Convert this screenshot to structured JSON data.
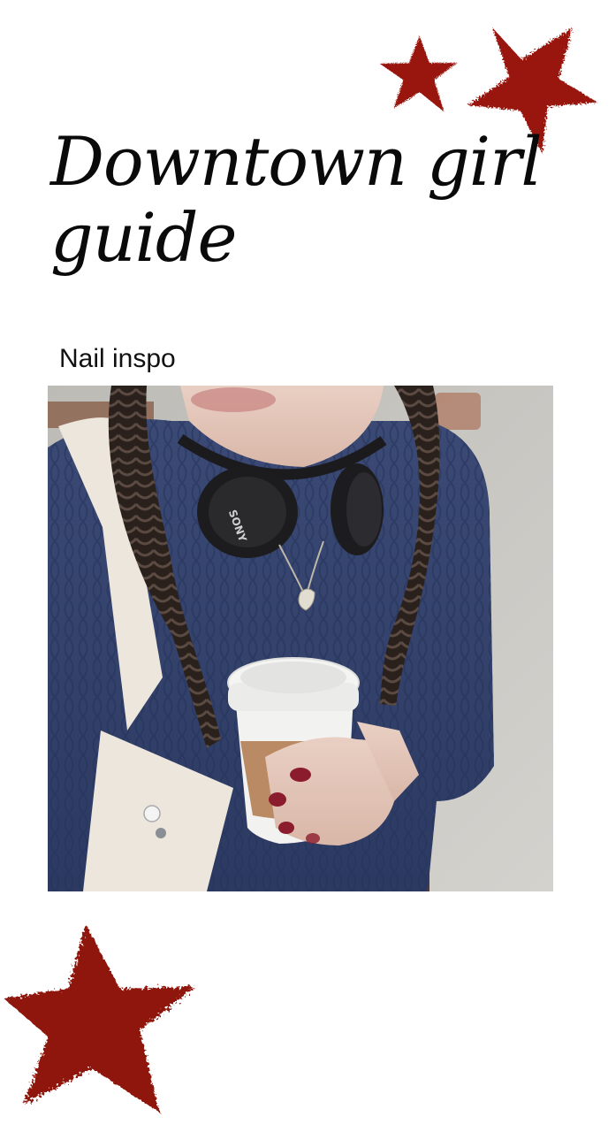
{
  "page": {
    "title": "Downtown girl guide",
    "section_label": "Nail inspo"
  },
  "decorations": {
    "star_color": "#9a1a12",
    "stars": [
      "star-icon",
      "star-icon",
      "star-icon"
    ]
  },
  "photo": {
    "brand_on_headphones": "SONY"
  }
}
